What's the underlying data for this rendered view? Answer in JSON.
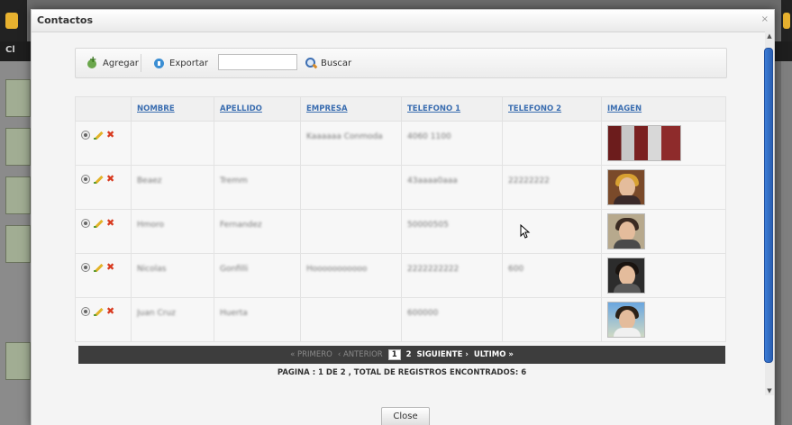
{
  "modal": {
    "title": "Contactos",
    "close_x": "×",
    "close_button": "Close"
  },
  "background": {
    "bar_label": "Cl"
  },
  "toolbar": {
    "add_label": "Agregar",
    "export_label": "Exportar",
    "search_value": "",
    "search_label": "Buscar"
  },
  "table": {
    "columns": [
      "NOMBRE",
      "APELLIDO",
      "EMPRESA",
      "TELEFONO 1",
      "TELEFONO 2",
      "IMAGEN"
    ],
    "rows": [
      {
        "nombre": "",
        "apellido": "",
        "empresa": "Kaaaaaa Conmoda",
        "telefono1": "4060 1100",
        "telefono2": "",
        "imagen": "group-photo"
      },
      {
        "nombre": "Beaez",
        "apellido": "Tremm",
        "empresa": "",
        "telefono1": "43aaaa0aaa",
        "telefono2": "22222222",
        "imagen": "woman-photo"
      },
      {
        "nombre": "Hmoro",
        "apellido": "Fernandez",
        "empresa": "",
        "telefono1": "50000505",
        "telefono2": "",
        "imagen": "man-photo"
      },
      {
        "nombre": "Nicolas",
        "apellido": "Gonfilli",
        "empresa": "Hooooooooooo",
        "telefono1": "2222222222",
        "telefono2": "600",
        "imagen": "man-dark-photo"
      },
      {
        "nombre": "Juan Cruz",
        "apellido": "Huerta",
        "empresa": "",
        "telefono1": "600000",
        "telefono2": "",
        "imagen": "man-outdoor-photo"
      }
    ]
  },
  "pager": {
    "first": "« PRIMERO",
    "previous": "‹ ANTERIOR",
    "page1": "1",
    "page2": "2",
    "next": "SIGUIENTE ›",
    "last": "ULTIMO »",
    "info": "PAGINA : 1 DE 2 , TOTAL DE REGISTROS ENCONTRADOS: 6"
  },
  "colors": {
    "header_link": "#3a6db0",
    "pager_bg": "#3d3d3d",
    "delete_icon": "#d83a1f",
    "scroll_thumb": "#2f6cc4"
  }
}
